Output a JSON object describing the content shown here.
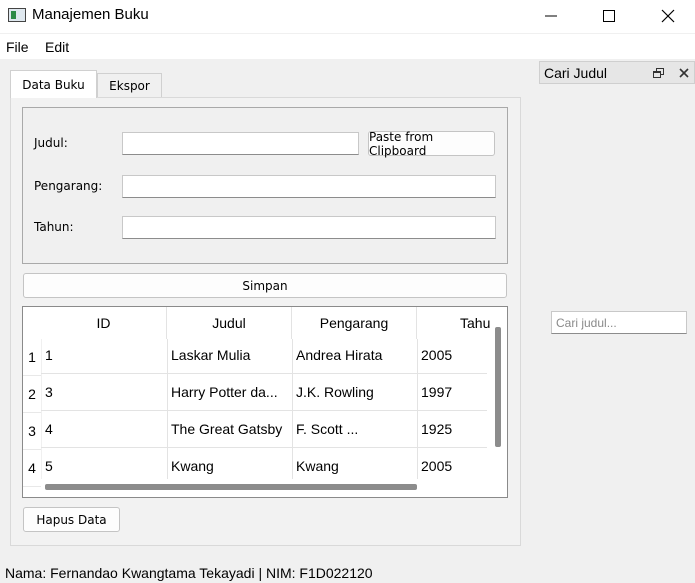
{
  "window": {
    "title": "Manajemen Buku"
  },
  "menu": {
    "items": [
      "File",
      "Edit"
    ]
  },
  "tabs": [
    {
      "label": "Data Buku",
      "active": true
    },
    {
      "label": "Ekspor",
      "active": false
    }
  ],
  "form": {
    "judul_label": "Judul:",
    "judul_value": "",
    "paste_label": "Paste from Clipboard",
    "pengarang_label": "Pengarang:",
    "pengarang_value": "",
    "tahun_label": "Tahun:",
    "tahun_value": ""
  },
  "simpan_label": "Simpan",
  "table": {
    "headers": [
      "ID",
      "Judul",
      "Pengarang",
      "Tahu"
    ],
    "row_numbers": [
      "1",
      "2",
      "3",
      "4"
    ],
    "rows": [
      [
        "1",
        "Laskar Mulia",
        "Andrea Hirata",
        "2005"
      ],
      [
        "3",
        "Harry Potter da...",
        "J.K. Rowling",
        "1997"
      ],
      [
        "4",
        "The Great Gatsby",
        "F. Scott ...",
        "1925"
      ],
      [
        "5",
        "Kwang",
        "Kwang",
        "2005"
      ]
    ]
  },
  "hapus_label": "Hapus Data",
  "dock": {
    "title": "Cari Judul",
    "search_placeholder": "Cari judul...",
    "search_value": ""
  },
  "status": "Nama: Fernandao Kwangtama Tekayadi | NIM: F1D022120",
  "icons": {
    "app": "app-icon",
    "minimize": "minimize-icon",
    "maximize": "maximize-icon",
    "close": "close-icon",
    "dock_float": "float-icon",
    "dock_close": "close-icon"
  }
}
